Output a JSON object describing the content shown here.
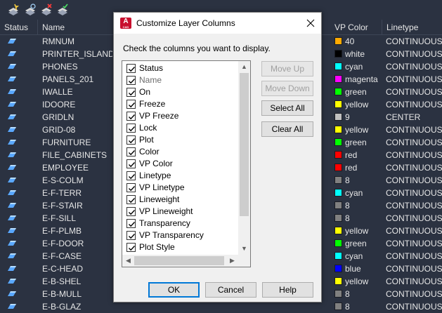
{
  "layer_manager": {
    "columns": {
      "status": "Status",
      "name": "Name",
      "vp_color": "VP Color",
      "linetype": "Linetype"
    },
    "rows": [
      {
        "name": "RMNUM",
        "color_name": "40",
        "color_hex": "#ffaa00",
        "linetype": "CONTINUOUS"
      },
      {
        "name": "PRINTER_ISLAND",
        "color_name": "white",
        "color_hex": "#000000",
        "linetype": "CONTINUOUS"
      },
      {
        "name": "PHONES",
        "color_name": "cyan",
        "color_hex": "#00ffff",
        "linetype": "CONTINUOUS"
      },
      {
        "name": "PANELS_201",
        "color_name": "magenta",
        "color_hex": "#ff00ff",
        "linetype": "CONTINUOUS"
      },
      {
        "name": "IWALLE",
        "color_name": "green",
        "color_hex": "#00ff00",
        "linetype": "CONTINUOUS"
      },
      {
        "name": "IDOORE",
        "color_name": "yellow",
        "color_hex": "#ffff00",
        "linetype": "CONTINUOUS"
      },
      {
        "name": "GRIDLN",
        "color_name": "9",
        "color_hex": "#c0c0c0",
        "linetype": "CENTER"
      },
      {
        "name": "GRID-08",
        "color_name": "yellow",
        "color_hex": "#ffff00",
        "linetype": "CONTINUOUS"
      },
      {
        "name": "FURNITURE",
        "color_name": "green",
        "color_hex": "#00ff00",
        "linetype": "CONTINUOUS"
      },
      {
        "name": "FILE_CABINETS",
        "color_name": "red",
        "color_hex": "#ff0000",
        "linetype": "CONTINUOUS"
      },
      {
        "name": "EMPLOYEE",
        "color_name": "red",
        "color_hex": "#ff0000",
        "linetype": "CONTINUOUS"
      },
      {
        "name": "E-S-COLM",
        "color_name": "8",
        "color_hex": "#808080",
        "linetype": "CONTINUOUS"
      },
      {
        "name": "E-F-TERR",
        "color_name": "cyan",
        "color_hex": "#00ffff",
        "linetype": "CONTINUOUS"
      },
      {
        "name": "E-F-STAIR",
        "color_name": "8",
        "color_hex": "#808080",
        "linetype": "CONTINUOUS"
      },
      {
        "name": "E-F-SILL",
        "color_name": "8",
        "color_hex": "#808080",
        "linetype": "CONTINUOUS"
      },
      {
        "name": "E-F-PLMB",
        "color_name": "yellow",
        "color_hex": "#ffff00",
        "linetype": "CONTINUOUS"
      },
      {
        "name": "E-F-DOOR",
        "color_name": "green",
        "color_hex": "#00ff00",
        "linetype": "CONTINUOUS"
      },
      {
        "name": "E-F-CASE",
        "color_name": "cyan",
        "color_hex": "#00ffff",
        "linetype": "CONTINUOUS"
      },
      {
        "name": "E-C-HEAD",
        "color_name": "blue",
        "color_hex": "#0000ff",
        "linetype": "CONTINUOUS"
      },
      {
        "name": "E-B-SHEL",
        "color_name": "yellow",
        "color_hex": "#ffff00",
        "linetype": "CONTINUOUS"
      },
      {
        "name": "E-B-MULL",
        "color_name": "8",
        "color_hex": "#808080",
        "linetype": "CONTINUOUS"
      },
      {
        "name": "E-B-GLAZ",
        "color_name": "8",
        "color_hex": "#808080",
        "linetype": "CONTINUOUS"
      }
    ],
    "status_icon": "layer-status-icon"
  },
  "dialog": {
    "title": "Customize Layer Columns",
    "instruction": "Check the columns you want to display.",
    "columns": [
      {
        "label": "Status",
        "checked": true,
        "disabled": false
      },
      {
        "label": "Name",
        "checked": true,
        "disabled": true
      },
      {
        "label": "On",
        "checked": true,
        "disabled": false
      },
      {
        "label": "Freeze",
        "checked": true,
        "disabled": false
      },
      {
        "label": "VP Freeze",
        "checked": true,
        "disabled": false
      },
      {
        "label": "Lock",
        "checked": true,
        "disabled": false
      },
      {
        "label": "Plot",
        "checked": true,
        "disabled": false
      },
      {
        "label": "Color",
        "checked": true,
        "disabled": false
      },
      {
        "label": "VP Color",
        "checked": true,
        "disabled": false
      },
      {
        "label": "Linetype",
        "checked": true,
        "disabled": false
      },
      {
        "label": "VP Linetype",
        "checked": true,
        "disabled": false
      },
      {
        "label": "Lineweight",
        "checked": true,
        "disabled": false
      },
      {
        "label": "VP Lineweight",
        "checked": true,
        "disabled": false
      },
      {
        "label": "Transparency",
        "checked": true,
        "disabled": false
      },
      {
        "label": "VP Transparency",
        "checked": true,
        "disabled": false
      },
      {
        "label": "Plot Style",
        "checked": true,
        "disabled": false
      }
    ],
    "buttons": {
      "move_up": "Move Up",
      "move_down": "Move Down",
      "select_all": "Select All",
      "clear_all": "Clear All",
      "ok": "OK",
      "cancel": "Cancel",
      "help": "Help"
    },
    "icons": {
      "app": "autocad-app-icon",
      "close": "close-icon"
    },
    "colors": {
      "accent": "#0078d7",
      "app_icon": "#c8102e"
    }
  }
}
